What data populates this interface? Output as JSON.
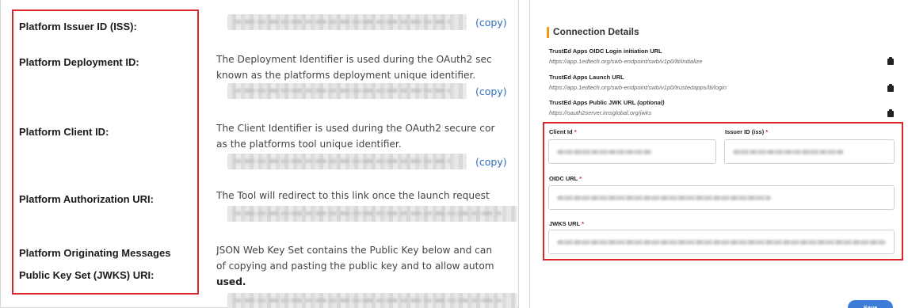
{
  "left": {
    "labels": {
      "issuer": "Platform Issuer ID (ISS):",
      "deployment": "Platform Deployment ID:",
      "client": "Platform Client ID:",
      "auth_uri": "Platform Authorization URI:",
      "jwks_line1": "Platform Originating Messages",
      "jwks_line2": "Public Key Set (JWKS) URI:"
    },
    "descriptions": {
      "deployment_1": "The Deployment Identifier is used during the OAuth2 sec",
      "deployment_2": "known as the platforms deployment unique identifier.",
      "client_1": "The Client Identifier is used during the OAuth2 secure cor",
      "client_2": "as the platforms tool unique identifier.",
      "auth_1": "The Tool will redirect to this link once the launch request",
      "jwks_1": "JSON Web Key Set contains the Public Key below and can",
      "jwks_2": "of copying and pasting the public key and to allow autom",
      "jwks_3": "used."
    },
    "copy_label": "(copy)"
  },
  "right": {
    "section_title": "Connection Details",
    "accent_color": "#f39c12",
    "items": [
      {
        "label": "TrustEd Apps OIDC Login initiation URL",
        "url": "https://app.1edtech.org/swb-endpoint/swb/v1p0/lti/initialize",
        "icon": "clipboard-icon"
      },
      {
        "label": "TrustEd Apps Launch URL",
        "url": "https://app.1edtech.org/swb-endpoint/swb/v1p0/trustedapps/lti/login",
        "icon": "clipboard-icon"
      },
      {
        "label": "TrustEd Apps Public JWK URL",
        "label_suffix": "(optional)",
        "url": "https://oauth2server.imsglobal.org/jwks",
        "icon": "clipboard-icon"
      }
    ],
    "form": {
      "client_id_label": "Client Id",
      "issuer_id_label": "Issuer ID (iss)",
      "oidc_url_label": "OIDC URL",
      "jwks_url_label": "JWKS URL",
      "required_mark": "*"
    },
    "save_label": "Save",
    "button_color": "#3d7dd8",
    "highlight_color": "#d9252b"
  }
}
